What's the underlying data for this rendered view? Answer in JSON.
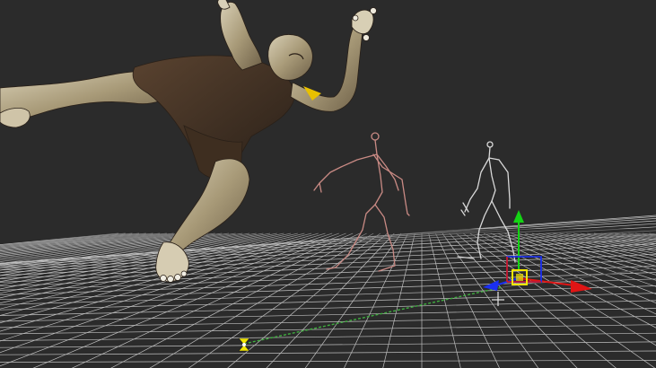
{
  "viewport": {
    "background_color": "#2b2b2b",
    "grid_color": "#d9d9d9",
    "axis_colors": {
      "x": "#e01515",
      "y": "#14d414",
      "z": "#1a2ff0"
    },
    "selection_color": "#f2e600",
    "rig_a_color": "#c98a84",
    "rig_b_color": "#d8d8d8",
    "icons": {
      "transform_gizmo": "translate-gizmo-icon",
      "camera_marker": "camera-pivot-icon",
      "null_marker": "null-cross-icon"
    }
  }
}
